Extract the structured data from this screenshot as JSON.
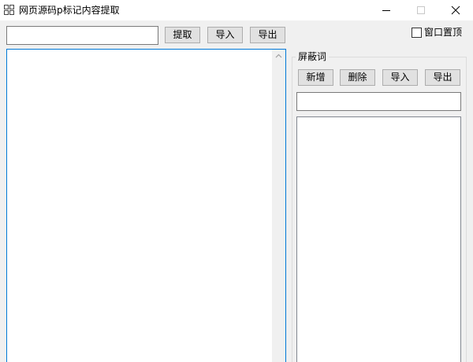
{
  "window": {
    "title": "网页源码p标记内容提取"
  },
  "toolbar": {
    "url_value": "",
    "extract_label": "提取",
    "import_label": "导入",
    "export_label": "导出",
    "topmost_label": "窗口置顶",
    "topmost_checked": false
  },
  "output": {
    "value": ""
  },
  "block_words": {
    "group_title": "屏蔽词",
    "add_label": "新增",
    "delete_label": "删除",
    "import_label": "导入",
    "export_label": "导出",
    "input_value": "",
    "items": []
  },
  "icons": {
    "app": "app-grid-icon",
    "minimize": "minimize-icon",
    "maximize": "maximize-icon",
    "close": "close-icon",
    "scroll_up": "chevron-up-icon"
  }
}
